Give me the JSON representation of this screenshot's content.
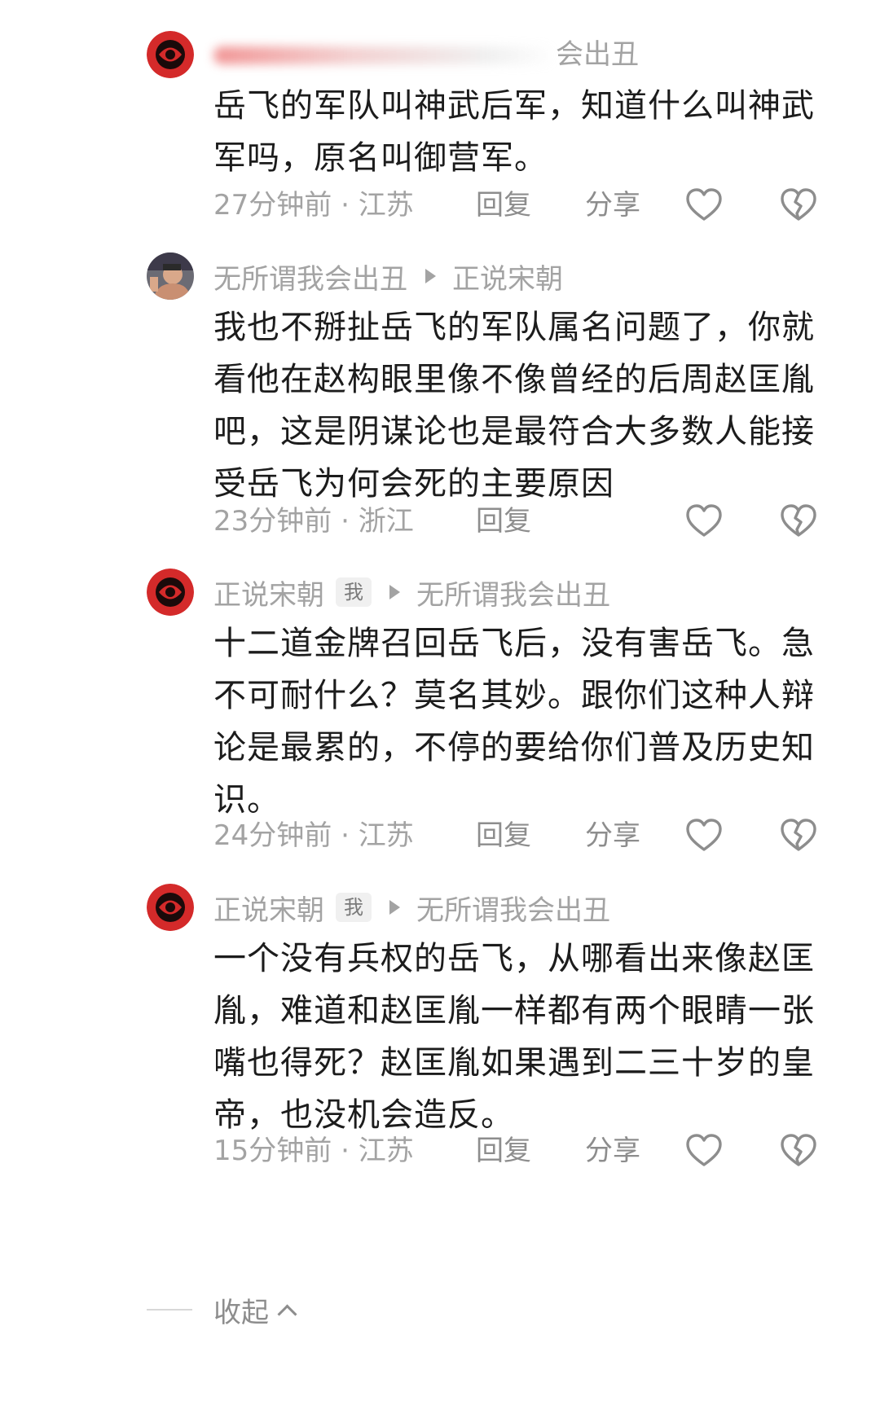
{
  "comments": [
    {
      "author": "无所谓我会出丑",
      "author_visible_tail": "会出丑",
      "author_blurred": true,
      "avatar": "red-emblem-avatar",
      "reply_to": "",
      "is_me": false,
      "text": "岳飞的军队叫神武后军，知道什么叫神武军吗，原名叫御营军。",
      "time": "27分钟前",
      "location": "江苏",
      "reply_label": "回复",
      "share_label": "分享",
      "show_share": true
    },
    {
      "author": "无所谓我会出丑",
      "avatar": "photo-avatar",
      "reply_to": "正说宋朝",
      "is_me": false,
      "text": "我也不掰扯岳飞的军队属名问题了，你就看他在赵构眼里像不像曾经的后周赵匡胤吧，这是阴谋论也是最符合大多数人能接受岳飞为何会死的主要原因",
      "time": "23分钟前",
      "location": "浙江",
      "reply_label": "回复",
      "share_label": "",
      "show_share": false
    },
    {
      "author": "正说宋朝",
      "avatar": "red-emblem-avatar",
      "reply_to": "无所谓我会出丑",
      "is_me": true,
      "me_badge": "我",
      "text": "十二道金牌召回岳飞后，没有害岳飞。急不可耐什么？莫名其妙。跟你们这种人辩论是最累的，不停的要给你们普及历史知识。",
      "time": "24分钟前",
      "location": "江苏",
      "reply_label": "回复",
      "share_label": "分享",
      "show_share": true
    },
    {
      "author": "正说宋朝",
      "avatar": "red-emblem-avatar",
      "reply_to": "无所谓我会出丑",
      "is_me": true,
      "me_badge": "我",
      "text": "一个没有兵权的岳飞，从哪看出来像赵匡胤，难道和赵匡胤一样都有两个眼睛一张嘴也得死？赵匡胤如果遇到二三十岁的皇帝，也没机会造反。",
      "time": "15分钟前",
      "location": "江苏",
      "reply_label": "回复",
      "share_label": "分享",
      "show_share": true
    }
  ],
  "separator": "·",
  "collapse": {
    "label": "收起",
    "icon": "chevron-up-icon"
  },
  "icons": {
    "like": "heart-icon",
    "dislike": "broken-heart-icon"
  },
  "colors": {
    "meta_gray": "#a3a3a3",
    "action_gray": "#8d8d8d",
    "text": "#1c1c1c",
    "avatar_red": "#d42a2a"
  }
}
